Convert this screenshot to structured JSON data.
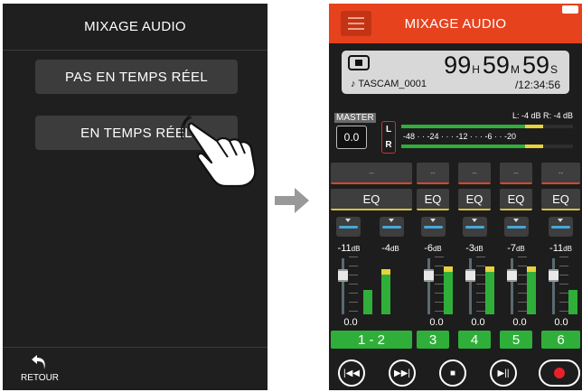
{
  "left": {
    "title": "MIXAGE AUDIO",
    "buttons": [
      "PAS EN TEMPS RÉEL",
      "EN TEMPS RÉEL"
    ],
    "back_label": "RETOUR"
  },
  "right": {
    "title": "MIXAGE AUDIO",
    "time": {
      "hours": "99",
      "h_unit": "H",
      "minutes": "59",
      "m_unit": "M",
      "seconds": "59",
      "s_unit": "S"
    },
    "file_name": "♪ TASCAM_0001",
    "total_time": "/12:34:56",
    "master": {
      "label": "MASTER",
      "value": "0.0",
      "lr_l": "L",
      "lr_r": "R",
      "level_readout": "L: -4 dB R: -4 dB",
      "scale": "-48 · · -24 · · · -12 · · · -6 · · -20",
      "meter_level_fraction": 0.72
    },
    "channels": [
      {
        "name": "--",
        "eq": "EQ",
        "level": "-11",
        "value": "0.0",
        "button": "1 - 2",
        "meter": 0.45
      },
      {
        "name": "--",
        "eq": "EQ",
        "level": "-6",
        "value": "0.0",
        "button": "3",
        "meter": 0.78
      },
      {
        "name": "--",
        "eq": "EQ",
        "level": "-3",
        "value": "0.0",
        "button": "4",
        "meter": 0.78
      },
      {
        "name": "--",
        "eq": "EQ",
        "level": "-7",
        "value": "0.0",
        "button": "5",
        "meter": 0.78
      },
      {
        "name": "--",
        "eq": "EQ",
        "level": "-11",
        "value": "0.0",
        "button": "6",
        "meter": 0.45
      }
    ],
    "channel_second_level": "-4",
    "db_unit": "dB",
    "transport": [
      "skip-back-icon",
      "skip-forward-icon",
      "stop-icon",
      "play-pause-icon",
      "record-icon"
    ]
  },
  "colors": {
    "header": "#e6421e",
    "green": "#2faf3a",
    "yellow": "#e8d23c"
  }
}
